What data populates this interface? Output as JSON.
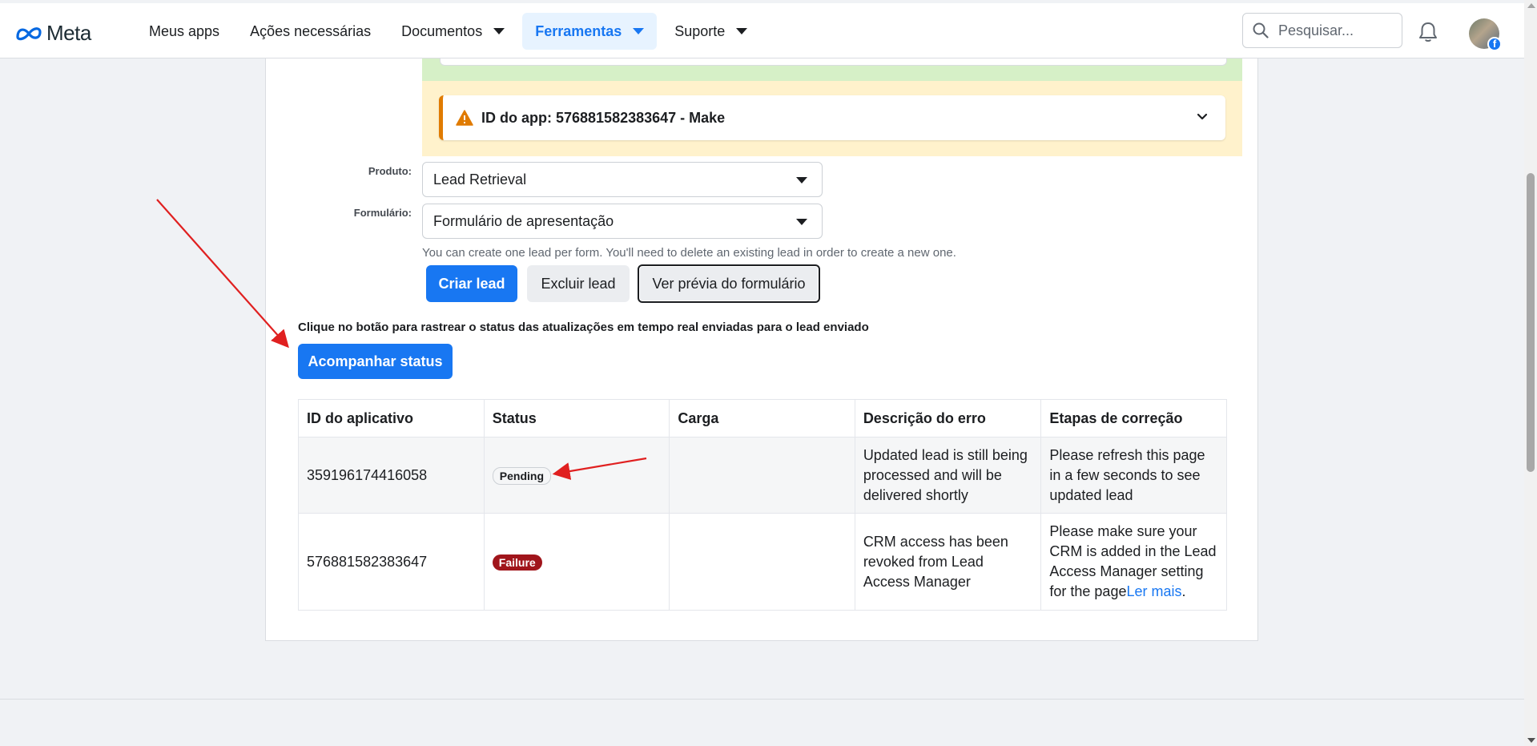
{
  "brand": {
    "name": "Meta",
    "accent": "#1877f2"
  },
  "nav": {
    "items": [
      {
        "label": "Meus apps"
      },
      {
        "label": "Ações necessárias"
      },
      {
        "label": "Documentos"
      },
      {
        "label": "Ferramentas"
      },
      {
        "label": "Suporte"
      }
    ],
    "active": "Ferramentas"
  },
  "search": {
    "placeholder": "Pesquisar..."
  },
  "warning": {
    "text": "ID do app: 576881582383647 - Make",
    "color": "#e07b00"
  },
  "form": {
    "product_label": "Produto:",
    "product_value": "Lead Retrieval",
    "form_label": "Formulário:",
    "form_value": "Formulário de apresentação",
    "hint": "You can create one lead per form. You'll need to delete an existing lead in order to create a new one.",
    "create_button": "Criar lead",
    "delete_button": "Excluir lead",
    "preview_button": "Ver prévia do formulário"
  },
  "track": {
    "description": "Clique no botão para rastrear o status das atualizações em tempo real enviadas para o lead enviado",
    "button": "Acompanhar status"
  },
  "table": {
    "headers": [
      "ID do aplicativo",
      "Status",
      "Carga",
      "Descrição do erro",
      "Etapas de correção"
    ],
    "rows": [
      {
        "app_id": "359196174416058",
        "status": "Pending",
        "payload": "",
        "error": "Updated lead is still being processed and will be delivered shortly",
        "fix": "Please refresh this page in a few seconds to see updated lead"
      },
      {
        "app_id": "576881582383647",
        "status": "Failure",
        "payload": "",
        "error": "CRM access has been revoked from Lead Access Manager",
        "fix": "Please make sure your CRM is added in the Lead Access Manager setting for the page",
        "fix_link": "Ler mais"
      }
    ]
  },
  "annotation_color": "#e02020"
}
